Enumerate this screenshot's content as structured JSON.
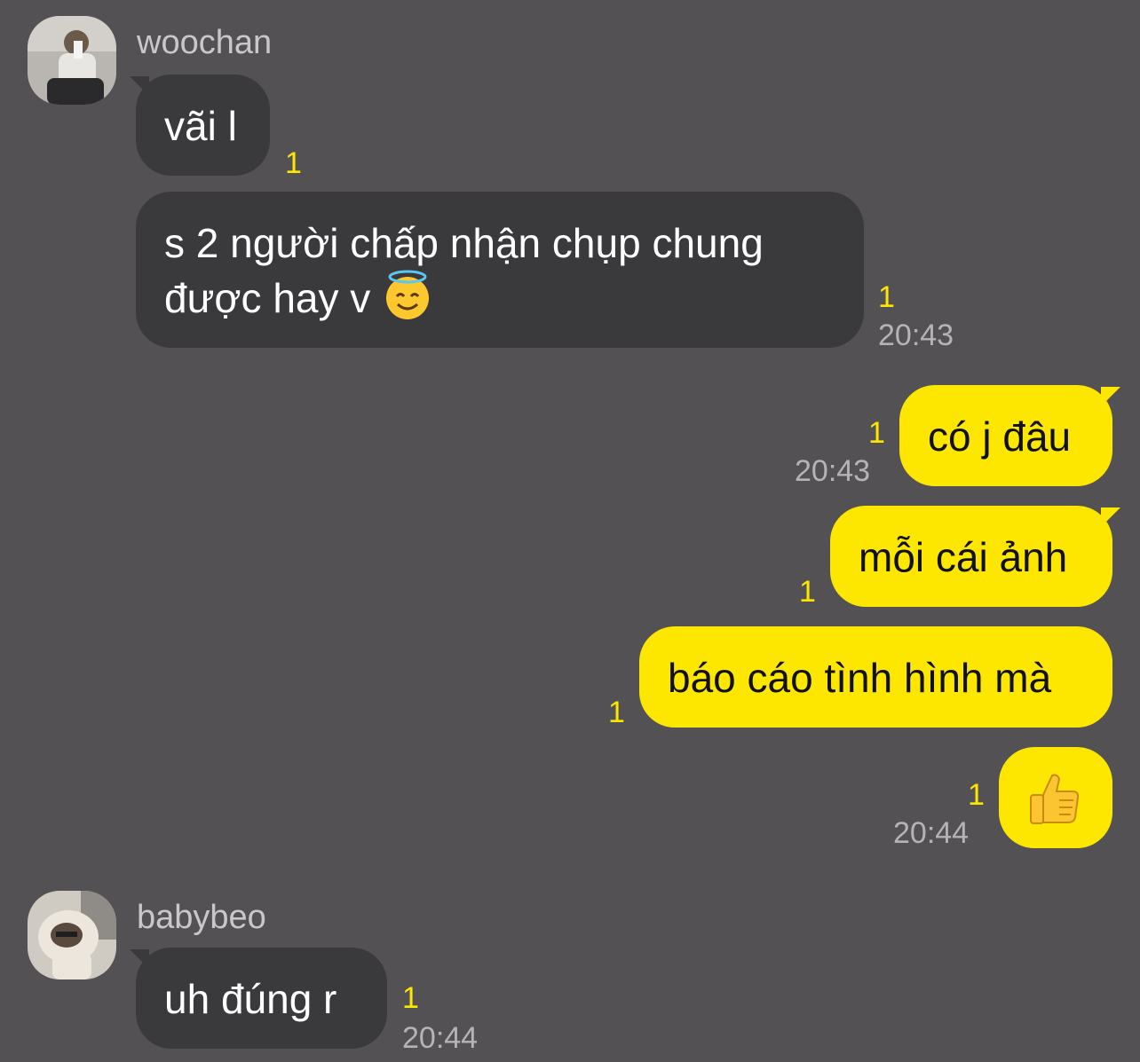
{
  "messages": [
    {
      "sender": "woochan",
      "text": "vãi l",
      "unread": "1"
    },
    {
      "text_line1": "s 2 người chấp nhận chụp chung",
      "text_line2": "được hay v",
      "emoji": "smiling-face-with-halo",
      "unread": "1",
      "time": "20:43"
    },
    {
      "text": "có j đâu",
      "unread": "1",
      "time": "20:43"
    },
    {
      "text": "mỗi cái ảnh",
      "unread": "1"
    },
    {
      "text": "báo cáo tình hình mà",
      "unread": "1"
    },
    {
      "emoji": "thumbs-up",
      "unread": "1",
      "time": "20:44"
    },
    {
      "sender": "babybeo",
      "text": "uh đúng r",
      "unread": "1",
      "time": "20:44"
    }
  ],
  "colors": {
    "background": "#535154",
    "incoming_bubble": "#3a393c",
    "outgoing_bubble": "#fde700",
    "unread_count": "#fde700",
    "timestamp": "#b5b3b6"
  }
}
